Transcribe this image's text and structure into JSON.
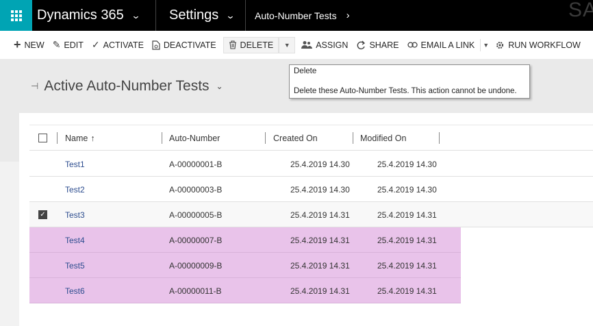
{
  "topnav": {
    "app_title": "Dynamics 365",
    "area_title": "Settings",
    "entity_title": "Auto-Number Tests",
    "ghost_logo": "SA"
  },
  "cmdbar": {
    "new": "NEW",
    "edit": "EDIT",
    "activate": "ACTIVATE",
    "deactivate": "DEACTIVATE",
    "delete": "DELETE",
    "assign": "ASSIGN",
    "share": "SHARE",
    "email_link": "EMAIL A LINK",
    "run_workflow": "RUN WORKFLOW"
  },
  "tooltip": {
    "title": "Delete",
    "description": "Delete these Auto-Number Tests. This action cannot be undone."
  },
  "view": {
    "title": "Active Auto-Number Tests"
  },
  "grid": {
    "columns": {
      "name": "Name",
      "sort_indicator": "↑",
      "auto_number": "Auto-Number",
      "created_on": "Created On",
      "modified_on": "Modified On"
    },
    "rows": [
      {
        "name": "Test1",
        "auto_number": "A-00000001-B",
        "created_on": "25.4.2019 14.30",
        "modified_on": "25.4.2019 14.30",
        "checked": false,
        "highlighted": false
      },
      {
        "name": "Test2",
        "auto_number": "A-00000003-B",
        "created_on": "25.4.2019 14.30",
        "modified_on": "25.4.2019 14.30",
        "checked": false,
        "highlighted": false
      },
      {
        "name": "Test3",
        "auto_number": "A-00000005-B",
        "created_on": "25.4.2019 14.31",
        "modified_on": "25.4.2019 14.31",
        "checked": true,
        "highlighted": false
      },
      {
        "name": "Test4",
        "auto_number": "A-00000007-B",
        "created_on": "25.4.2019 14.31",
        "modified_on": "25.4.2019 14.31",
        "checked": false,
        "highlighted": true
      },
      {
        "name": "Test5",
        "auto_number": "A-00000009-B",
        "created_on": "25.4.2019 14.31",
        "modified_on": "25.4.2019 14.31",
        "checked": false,
        "highlighted": true
      },
      {
        "name": "Test6",
        "auto_number": "A-00000011-B",
        "created_on": "25.4.2019 14.31",
        "modified_on": "25.4.2019 14.31",
        "checked": false,
        "highlighted": true
      }
    ]
  },
  "colors": {
    "waffle": "#00a4b4",
    "topnav": "#000000",
    "highlight_row": "#e9c3ea",
    "link": "#2d4d8f"
  }
}
